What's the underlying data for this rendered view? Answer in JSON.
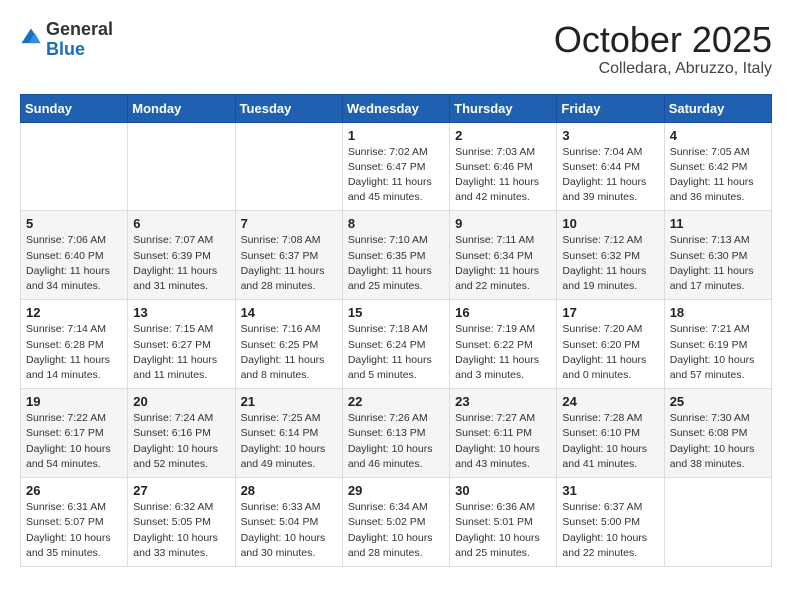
{
  "header": {
    "logo": {
      "general": "General",
      "blue": "Blue"
    },
    "title": "October 2025",
    "location": "Colledara, Abruzzo, Italy"
  },
  "weekdays": [
    "Sunday",
    "Monday",
    "Tuesday",
    "Wednesday",
    "Thursday",
    "Friday",
    "Saturday"
  ],
  "weeks": [
    [
      {
        "day": "",
        "info": ""
      },
      {
        "day": "",
        "info": ""
      },
      {
        "day": "",
        "info": ""
      },
      {
        "day": "1",
        "info": "Sunrise: 7:02 AM\nSunset: 6:47 PM\nDaylight: 11 hours and 45 minutes."
      },
      {
        "day": "2",
        "info": "Sunrise: 7:03 AM\nSunset: 6:46 PM\nDaylight: 11 hours and 42 minutes."
      },
      {
        "day": "3",
        "info": "Sunrise: 7:04 AM\nSunset: 6:44 PM\nDaylight: 11 hours and 39 minutes."
      },
      {
        "day": "4",
        "info": "Sunrise: 7:05 AM\nSunset: 6:42 PM\nDaylight: 11 hours and 36 minutes."
      }
    ],
    [
      {
        "day": "5",
        "info": "Sunrise: 7:06 AM\nSunset: 6:40 PM\nDaylight: 11 hours and 34 minutes."
      },
      {
        "day": "6",
        "info": "Sunrise: 7:07 AM\nSunset: 6:39 PM\nDaylight: 11 hours and 31 minutes."
      },
      {
        "day": "7",
        "info": "Sunrise: 7:08 AM\nSunset: 6:37 PM\nDaylight: 11 hours and 28 minutes."
      },
      {
        "day": "8",
        "info": "Sunrise: 7:10 AM\nSunset: 6:35 PM\nDaylight: 11 hours and 25 minutes."
      },
      {
        "day": "9",
        "info": "Sunrise: 7:11 AM\nSunset: 6:34 PM\nDaylight: 11 hours and 22 minutes."
      },
      {
        "day": "10",
        "info": "Sunrise: 7:12 AM\nSunset: 6:32 PM\nDaylight: 11 hours and 19 minutes."
      },
      {
        "day": "11",
        "info": "Sunrise: 7:13 AM\nSunset: 6:30 PM\nDaylight: 11 hours and 17 minutes."
      }
    ],
    [
      {
        "day": "12",
        "info": "Sunrise: 7:14 AM\nSunset: 6:28 PM\nDaylight: 11 hours and 14 minutes."
      },
      {
        "day": "13",
        "info": "Sunrise: 7:15 AM\nSunset: 6:27 PM\nDaylight: 11 hours and 11 minutes."
      },
      {
        "day": "14",
        "info": "Sunrise: 7:16 AM\nSunset: 6:25 PM\nDaylight: 11 hours and 8 minutes."
      },
      {
        "day": "15",
        "info": "Sunrise: 7:18 AM\nSunset: 6:24 PM\nDaylight: 11 hours and 5 minutes."
      },
      {
        "day": "16",
        "info": "Sunrise: 7:19 AM\nSunset: 6:22 PM\nDaylight: 11 hours and 3 minutes."
      },
      {
        "day": "17",
        "info": "Sunrise: 7:20 AM\nSunset: 6:20 PM\nDaylight: 11 hours and 0 minutes."
      },
      {
        "day": "18",
        "info": "Sunrise: 7:21 AM\nSunset: 6:19 PM\nDaylight: 10 hours and 57 minutes."
      }
    ],
    [
      {
        "day": "19",
        "info": "Sunrise: 7:22 AM\nSunset: 6:17 PM\nDaylight: 10 hours and 54 minutes."
      },
      {
        "day": "20",
        "info": "Sunrise: 7:24 AM\nSunset: 6:16 PM\nDaylight: 10 hours and 52 minutes."
      },
      {
        "day": "21",
        "info": "Sunrise: 7:25 AM\nSunset: 6:14 PM\nDaylight: 10 hours and 49 minutes."
      },
      {
        "day": "22",
        "info": "Sunrise: 7:26 AM\nSunset: 6:13 PM\nDaylight: 10 hours and 46 minutes."
      },
      {
        "day": "23",
        "info": "Sunrise: 7:27 AM\nSunset: 6:11 PM\nDaylight: 10 hours and 43 minutes."
      },
      {
        "day": "24",
        "info": "Sunrise: 7:28 AM\nSunset: 6:10 PM\nDaylight: 10 hours and 41 minutes."
      },
      {
        "day": "25",
        "info": "Sunrise: 7:30 AM\nSunset: 6:08 PM\nDaylight: 10 hours and 38 minutes."
      }
    ],
    [
      {
        "day": "26",
        "info": "Sunrise: 6:31 AM\nSunset: 5:07 PM\nDaylight: 10 hours and 35 minutes."
      },
      {
        "day": "27",
        "info": "Sunrise: 6:32 AM\nSunset: 5:05 PM\nDaylight: 10 hours and 33 minutes."
      },
      {
        "day": "28",
        "info": "Sunrise: 6:33 AM\nSunset: 5:04 PM\nDaylight: 10 hours and 30 minutes."
      },
      {
        "day": "29",
        "info": "Sunrise: 6:34 AM\nSunset: 5:02 PM\nDaylight: 10 hours and 28 minutes."
      },
      {
        "day": "30",
        "info": "Sunrise: 6:36 AM\nSunset: 5:01 PM\nDaylight: 10 hours and 25 minutes."
      },
      {
        "day": "31",
        "info": "Sunrise: 6:37 AM\nSunset: 5:00 PM\nDaylight: 10 hours and 22 minutes."
      },
      {
        "day": "",
        "info": ""
      }
    ]
  ]
}
